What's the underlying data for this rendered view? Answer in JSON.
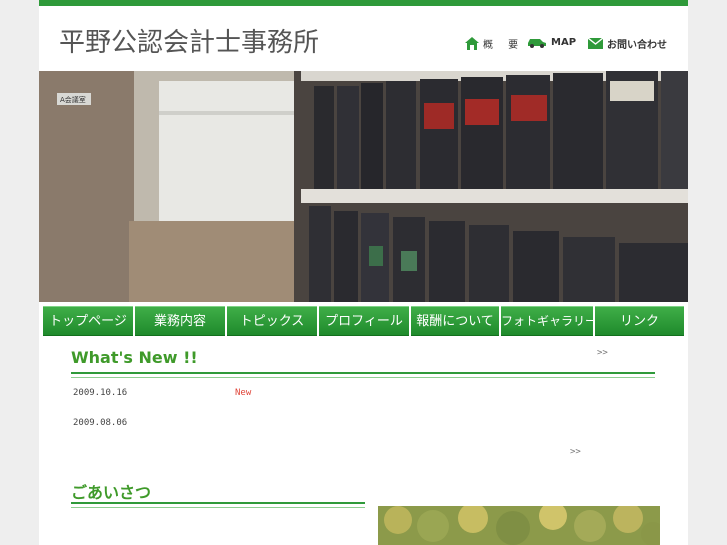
{
  "site": {
    "title": "平野公認会計士事務所"
  },
  "util_nav": [
    {
      "label": "概 要",
      "icon": "house-icon"
    },
    {
      "label": "MAP",
      "icon": "car-icon"
    },
    {
      "label": "お問い合わせ",
      "icon": "envelope-icon"
    }
  ],
  "hero": {
    "sign_text": "A会議室"
  },
  "global_nav": [
    {
      "label": "トップページ"
    },
    {
      "label": "業務内容"
    },
    {
      "label": "トピックス"
    },
    {
      "label": "プロフィール"
    },
    {
      "label": "報酬について"
    },
    {
      "label": "フォトギャラリー"
    },
    {
      "label": "リンク"
    }
  ],
  "whats_new": {
    "title": "What's New !!",
    "more_label": ">>",
    "items": [
      {
        "date": "2009.10.16",
        "badge": "New"
      },
      {
        "date": "2009.08.06"
      }
    ],
    "bottom_more_label": ">>"
  },
  "greeting": {
    "title": "ごあいさつ"
  },
  "colors": {
    "brand_green": "#2f9a3a",
    "heading_green": "#3f9a2a",
    "badge_red": "#e0463a"
  }
}
